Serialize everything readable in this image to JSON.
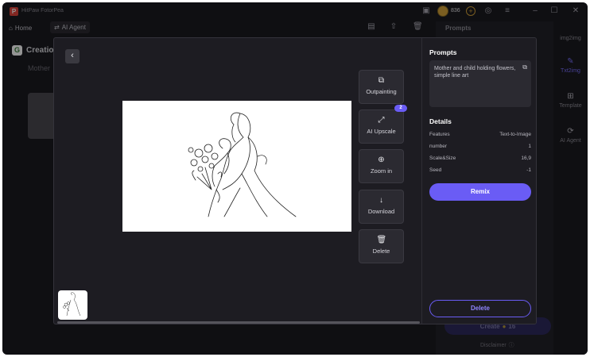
{
  "app": {
    "title": "HitPaw FotorPea",
    "logo_letter": "P",
    "coins": "836",
    "icons": [
      "box-icon",
      "coin-icon",
      "plus-circle-icon",
      "user-icon",
      "menu-icon",
      "minimize-icon",
      "maximize-icon",
      "close-icon"
    ]
  },
  "nav": {
    "home": "Home",
    "ai_agent": "AI Agent"
  },
  "background": {
    "creation_title": "Creation",
    "prompt_preview": "Mother",
    "prompts_label": "Prompts",
    "create_label": "Create",
    "create_cost": "16",
    "disclaimer": "Disclaimer"
  },
  "rail": [
    {
      "label": "img2img",
      "icon": "image-icon"
    },
    {
      "label": "Txt2img",
      "icon": "text-to-image-icon",
      "active": true
    },
    {
      "label": "Template",
      "icon": "template-icon"
    },
    {
      "label": "AI Agent",
      "icon": "agent-icon"
    }
  ],
  "modal": {
    "tools": [
      {
        "label": "Outpainting",
        "icon": "outpaint-icon"
      },
      {
        "label": "AI Upscale",
        "icon": "upscale-icon",
        "badge": "2"
      },
      {
        "label": "Zoom in",
        "icon": "zoom-in-icon"
      },
      {
        "label": "Download",
        "icon": "download-icon"
      },
      {
        "label": "Delete",
        "icon": "trash-icon"
      }
    ],
    "panel": {
      "prompts_title": "Prompts",
      "prompt_text": "Mother and child holding flowers, simple line art",
      "details_title": "Details",
      "details": [
        {
          "key": "Features",
          "value": "Text-to-Image"
        },
        {
          "key": "number",
          "value": "1"
        },
        {
          "key": "Scale&Size",
          "value": "16,9"
        },
        {
          "key": "Seed",
          "value": "-1"
        }
      ],
      "remix_label": "Remix",
      "delete_label": "Delete"
    }
  },
  "colors": {
    "accent": "#6a5cf5",
    "background": "#1b1a20",
    "panel": "#2b2a31"
  }
}
